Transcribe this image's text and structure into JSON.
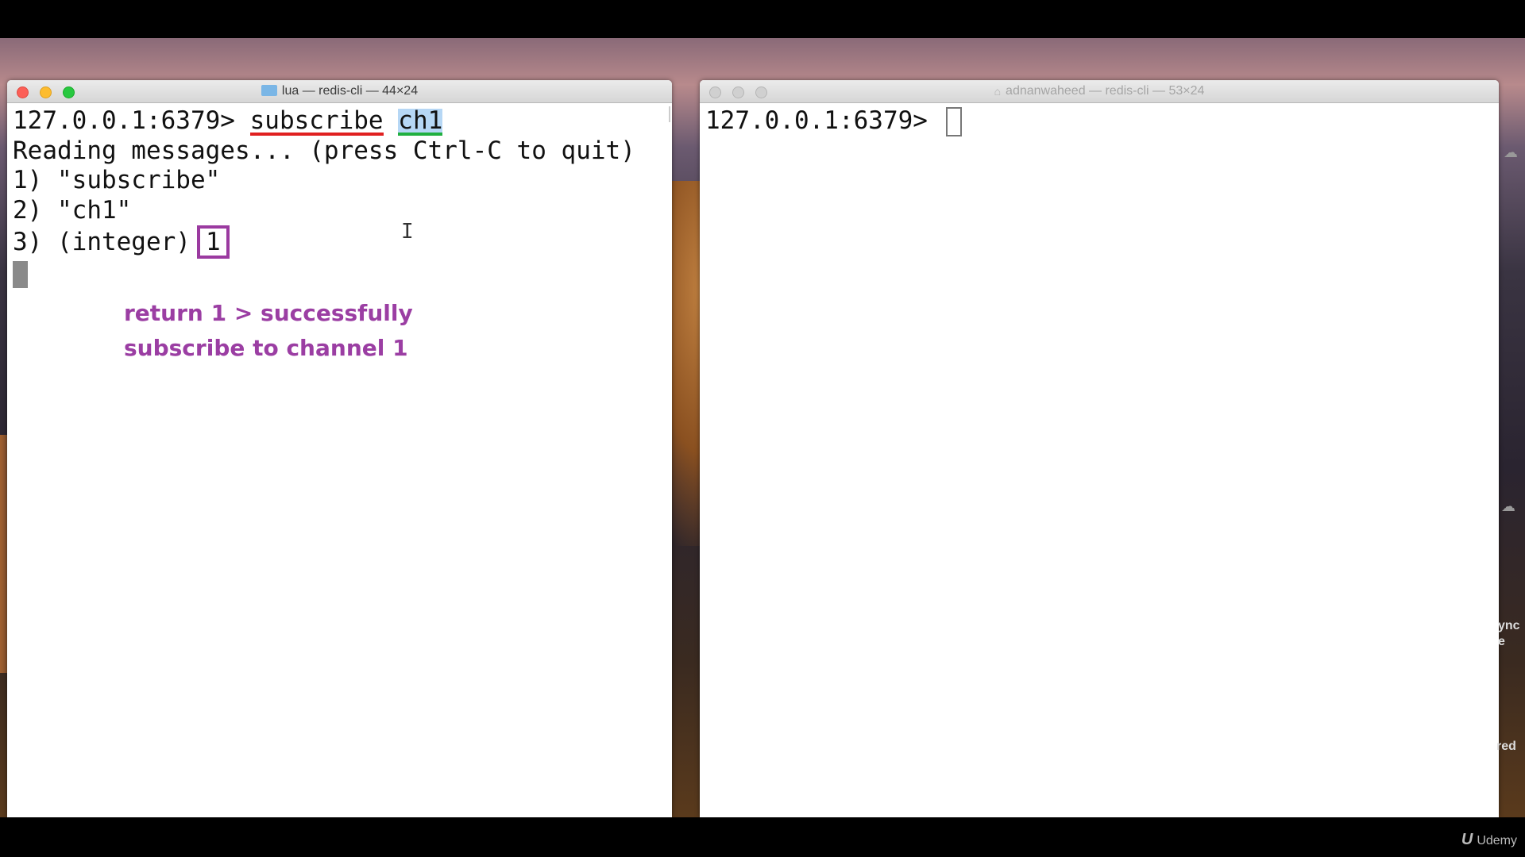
{
  "left_window": {
    "title": "lua — redis-cli — 44×24",
    "prompt": "127.0.0.1:6379> ",
    "command": "subscribe",
    "argument": "ch1",
    "lines": [
      "Reading messages... (press Ctrl-C to quit)",
      "1) \"subscribe\"",
      "2) \"ch1\""
    ],
    "line3_prefix": "3) (integer)",
    "line3_value": "1"
  },
  "right_window": {
    "title": "adnanwaheed — redis-cli — 53×24",
    "prompt": "127.0.0.1:6379> "
  },
  "annotation": {
    "line1": "return 1 > successfully",
    "line2": "subscribe to channel 1",
    "color": "#9b3ea3"
  },
  "highlight_colors": {
    "command_underline": "#e02020",
    "argument_underline": "#20b040",
    "value_box": "#9b3aa0"
  },
  "desktop": {
    "side_labels": [
      "ync",
      "e",
      "red"
    ]
  },
  "watermark": "Udemy"
}
